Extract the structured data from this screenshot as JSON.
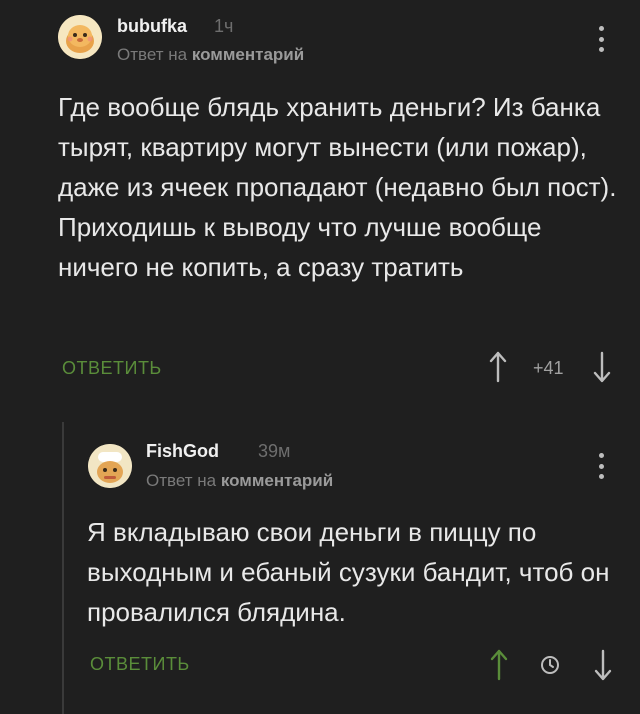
{
  "comments": [
    {
      "author": "bubufka",
      "time": "1ч",
      "reply_prefix": "Ответ на",
      "reply_link": "комментарий",
      "text": "Где вообще блядь хранить деньги? Из банка тырят, квартиру могут вынести (или пожар), даже из ячеек пропадают (недавно был пост). Приходишь к выводу что лучше вообще ничего не копить, а сразу тратить",
      "reply_label": "ОТВЕТИТЬ",
      "score": "+41"
    },
    {
      "author": "FishGod",
      "time": "39м",
      "reply_prefix": "Ответ на",
      "reply_link": "комментарий",
      "text": "Я вкладываю свои деньги в пиццу по выходным и ебаный сузуки бандит, чтоб он провалился блядина.",
      "reply_label": "ОТВЕТИТЬ"
    }
  ],
  "colors": {
    "background": "#1f1f1f",
    "accent_green": "#5a8d3a",
    "text": "#e8e8e8",
    "muted": "#7a7a7a"
  },
  "icons": [
    "avatar",
    "more-vertical-icon",
    "arrow-up-icon",
    "arrow-down-icon",
    "clock-icon"
  ]
}
